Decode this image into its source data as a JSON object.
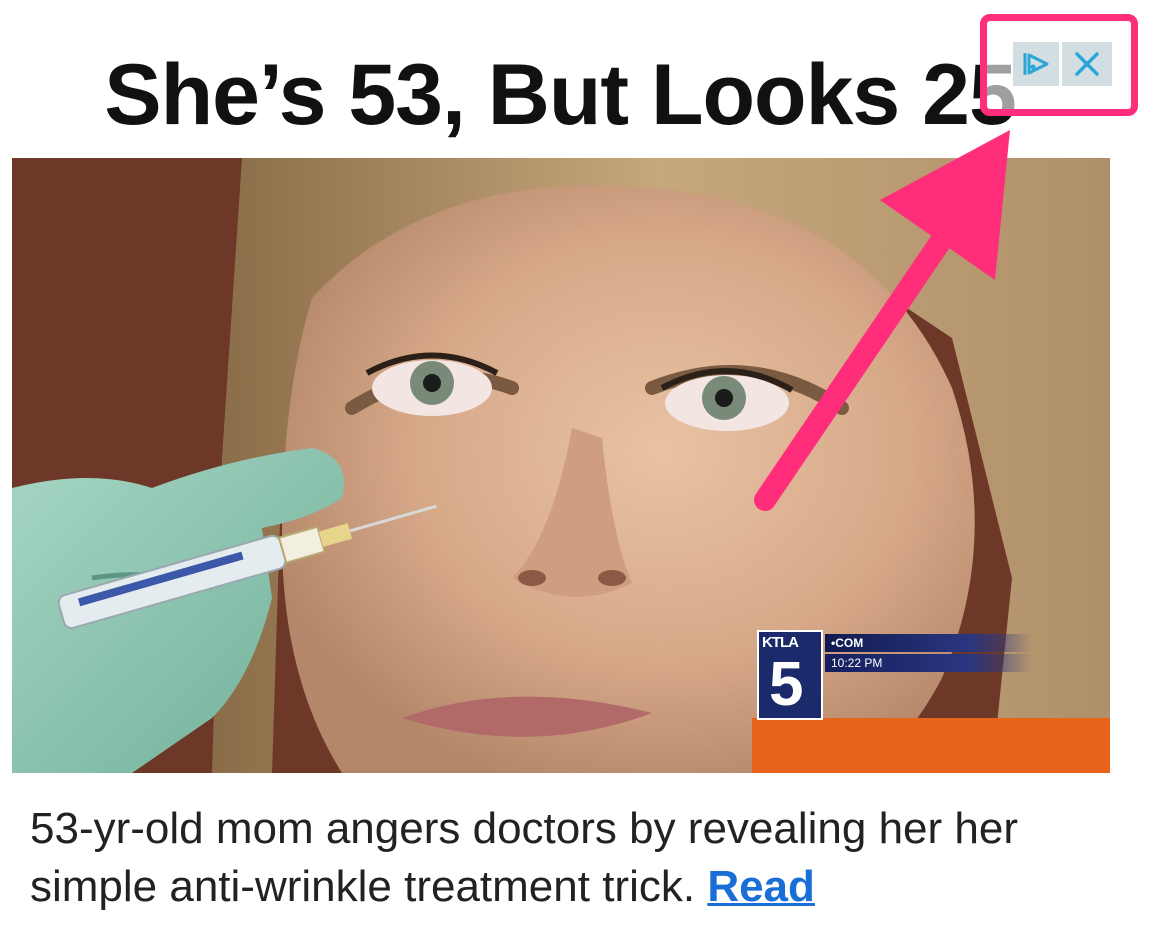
{
  "ad": {
    "headline": "She’s 53, But Looks 25",
    "caption_text": "53-yr-old mom angers doctors by revealing her her simple anti-wrinkle treatment trick.",
    "read_link": "Read",
    "image_alt": "woman-receiving-injection",
    "broadcast_overlay": {
      "station": "KTLA",
      "channel_number": "5",
      "line1": "•COM",
      "line2": "10:22 PM"
    }
  },
  "controls": {
    "adchoices_icon": "adchoices-icon",
    "close_icon": "close-icon"
  },
  "colors": {
    "highlight": "#ff2d7a",
    "link": "#1a6fd6",
    "adchoice_bg": "#d3dee2",
    "adchoice_fg": "#2aa6d8"
  }
}
